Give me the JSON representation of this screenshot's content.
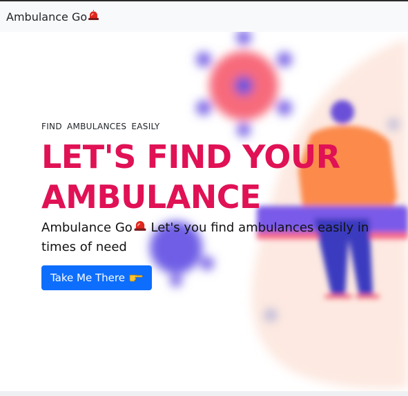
{
  "navbar": {
    "brand": "Ambulance Go",
    "brand_icon": "siren-icon"
  },
  "hero": {
    "eyebrow": "FIND AMBULANCES EASILY",
    "headline": "LET'S FIND YOUR AMBULANCE",
    "tagline": "Ambulance Go Let's you find ambulances easily in times of need",
    "tagline_brand": "Ambulance Go",
    "tagline_rest": " Let's you find ambulances easily in times of need",
    "cta_label": "Take Me There",
    "cta_icon": "pointing-hand-icon"
  },
  "colors": {
    "headline": "#e01155",
    "cta": "#0d6efd",
    "navbar": "#f8f9fa"
  }
}
